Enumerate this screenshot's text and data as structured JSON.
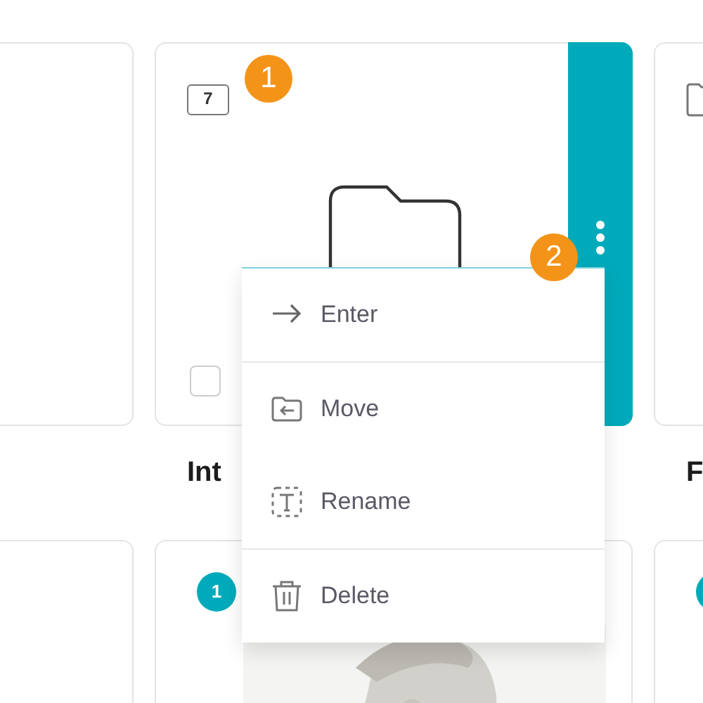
{
  "row_1": [
    {
      "kind": "blank"
    },
    {
      "kind": "folder",
      "count": "7",
      "callout": "1",
      "active": true,
      "checked": false,
      "menu_callout": "2",
      "title": "Int"
    },
    {
      "kind": "folder",
      "title": "F"
    }
  ],
  "row_2": [
    {
      "kind": "blank"
    },
    {
      "badge": "1"
    },
    {
      "kind": "badge"
    }
  ],
  "context_menu": {
    "groups": [
      [
        {
          "kind": "enter",
          "label": "Enter"
        }
      ],
      [
        {
          "kind": "move",
          "label": "Move"
        },
        {
          "kind": "rename",
          "label": "Rename"
        }
      ],
      [
        {
          "kind": "delete",
          "label": "Delete"
        }
      ]
    ]
  }
}
